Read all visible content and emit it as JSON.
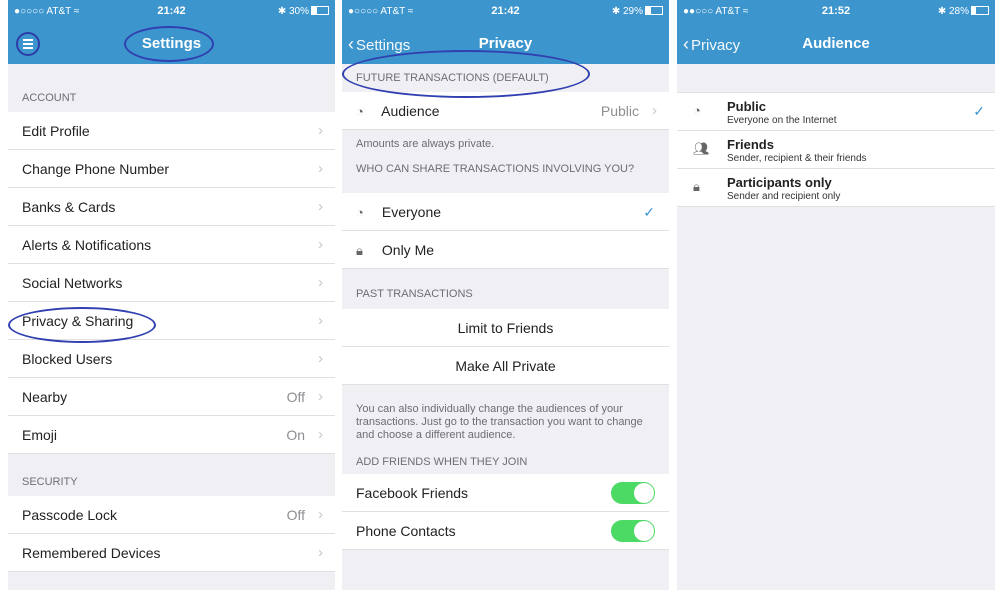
{
  "screen1": {
    "status": {
      "carrier": "●○○○○ AT&T ≈",
      "time": "21:42",
      "battery": "30%"
    },
    "title": "Settings",
    "account_header": "ACCOUNT",
    "items": [
      {
        "label": "Edit Profile",
        "value": ""
      },
      {
        "label": "Change Phone Number",
        "value": ""
      },
      {
        "label": "Banks & Cards",
        "value": ""
      },
      {
        "label": "Alerts & Notifications",
        "value": ""
      },
      {
        "label": "Social Networks",
        "value": ""
      },
      {
        "label": "Privacy & Sharing",
        "value": ""
      },
      {
        "label": "Blocked Users",
        "value": ""
      },
      {
        "label": "Nearby",
        "value": "Off"
      },
      {
        "label": "Emoji",
        "value": "On"
      }
    ],
    "security_header": "SECURITY",
    "security_items": [
      {
        "label": "Passcode Lock",
        "value": "Off"
      },
      {
        "label": "Remembered Devices",
        "value": ""
      }
    ]
  },
  "screen2": {
    "status": {
      "carrier": "●○○○○ AT&T ≈",
      "time": "21:42",
      "battery": "29%"
    },
    "back": "Settings",
    "title": "Privacy",
    "future_header": "FUTURE TRANSACTIONS (DEFAULT)",
    "audience_label": "Audience",
    "audience_value": "Public",
    "amounts_note": "Amounts are always private.",
    "share_header": "WHO CAN SHARE TRANSACTIONS INVOLVING YOU?",
    "everyone": "Everyone",
    "only_me": "Only Me",
    "past_header": "PAST TRANSACTIONS",
    "limit": "Limit to Friends",
    "make_private": "Make All Private",
    "individual_note": "You can also individually change the audiences of your transactions. Just go to the transaction you want to change and choose a different audience.",
    "add_header": "ADD FRIENDS WHEN THEY JOIN",
    "facebook": "Facebook Friends",
    "phone": "Phone Contacts"
  },
  "screen3": {
    "status": {
      "carrier": "●●○○○ AT&T ≈",
      "time": "21:52",
      "battery": "28%"
    },
    "back": "Privacy",
    "title": "Audience",
    "options": [
      {
        "title": "Public",
        "desc": "Everyone on the Internet",
        "icon": "globe-icon",
        "selected": true
      },
      {
        "title": "Friends",
        "desc": "Sender, recipient & their friends",
        "icon": "people-icon",
        "selected": false
      },
      {
        "title": "Participants only",
        "desc": "Sender and recipient only",
        "icon": "lock-icon",
        "selected": false
      }
    ]
  },
  "colors": {
    "accent": "#3d95ce",
    "toggle": "#4cd964",
    "annotation": "#3040b0"
  }
}
